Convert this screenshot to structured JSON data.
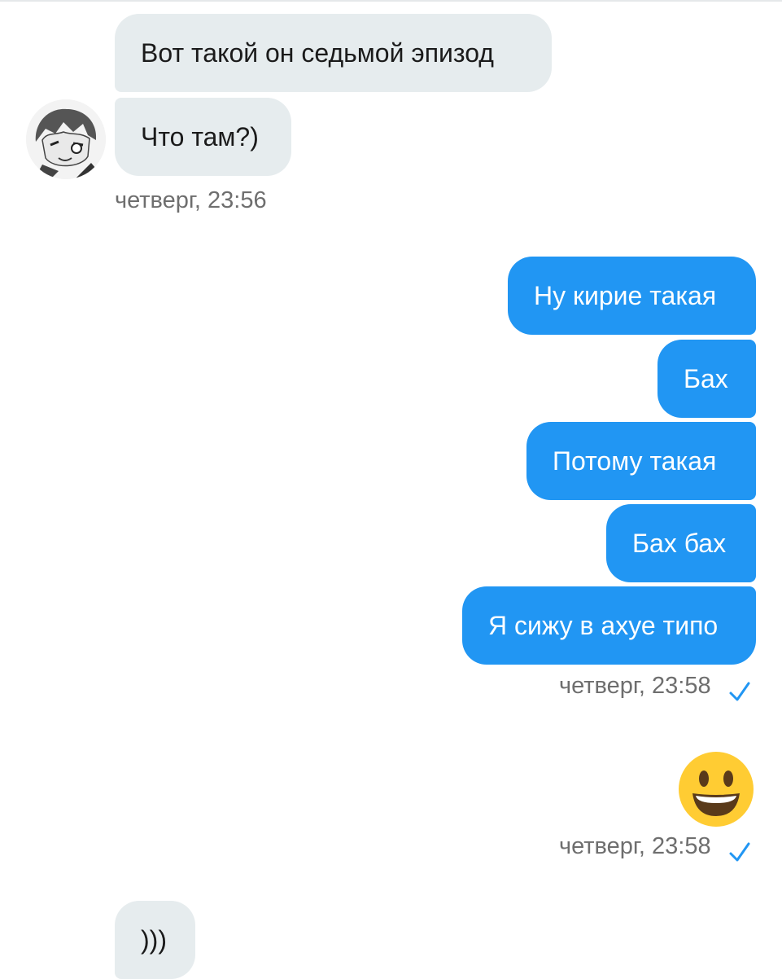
{
  "chat": {
    "incoming": [
      {
        "text": "Вот такой он седьмой эпизод"
      },
      {
        "text": "Что там?)"
      }
    ],
    "incoming_time": "четверг, 23:56",
    "outgoing": [
      {
        "text": "Ну кирие такая"
      },
      {
        "text": "Бах"
      },
      {
        "text": "Потому такая"
      },
      {
        "text": "Бах бах"
      },
      {
        "text": "Я сижу в ахуе типо"
      }
    ],
    "outgoing_time": "четверг, 23:58",
    "emoji_time": "четверг, 23:58",
    "emoji_icon": "grinning-face-emoji",
    "last_incoming": {
      "text": ")))"
    }
  },
  "colors": {
    "outgoing_bubble": "#2196f3",
    "incoming_bubble": "#e6ecee",
    "timestamp": "#6e6e6e",
    "check": "#2196f3"
  }
}
